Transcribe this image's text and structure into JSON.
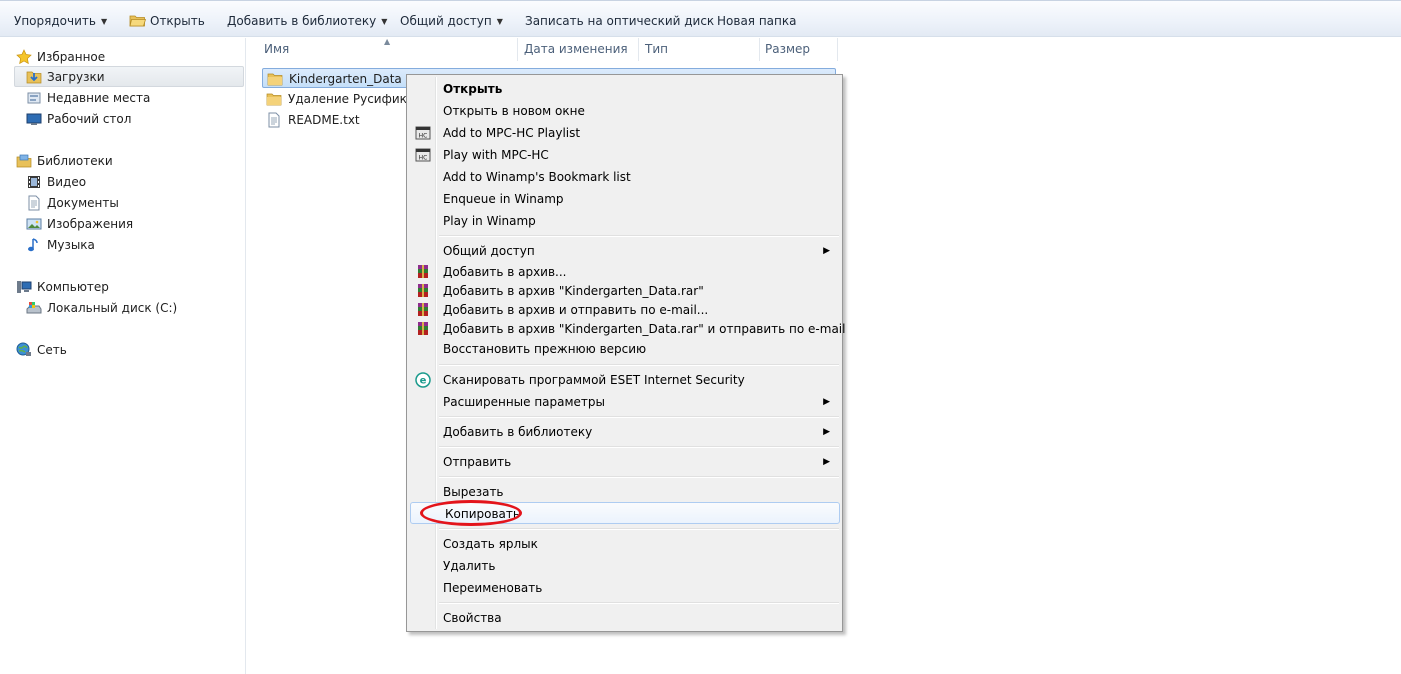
{
  "toolbar": {
    "organize": "Упорядочить",
    "open": "Открыть",
    "add_to_library": "Добавить в библиотеку",
    "share": "Общий доступ",
    "burn": "Записать на оптический диск",
    "new_folder": "Новая папка"
  },
  "nav": {
    "favorites": "Избранное",
    "downloads": "Загрузки",
    "recent": "Недавние места",
    "desktop": "Рабочий стол",
    "libraries": "Библиотеки",
    "video": "Видео",
    "documents": "Документы",
    "pictures": "Изображения",
    "music": "Музыка",
    "computer": "Компьютер",
    "local_disk": "Локальный диск (C:)",
    "network": "Сеть"
  },
  "columns": {
    "name": "Имя",
    "date": "Дата изменения",
    "type": "Тип",
    "size": "Размер"
  },
  "files": [
    {
      "name": "Kindergarten_Data",
      "icon": "folder-icon"
    },
    {
      "name": "Удаление Русификато",
      "icon": "folder-icon"
    },
    {
      "name": "README.txt",
      "icon": "text-file-icon"
    }
  ],
  "menu": {
    "open": "Открыть",
    "open_new_window": "Открыть в новом окне",
    "add_mpc_playlist": "Add to MPC-HC Playlist",
    "play_mpc": "Play with MPC-HC",
    "winamp_bookmark": "Add to Winamp's Bookmark list",
    "enqueue_winamp": "Enqueue in Winamp",
    "play_winamp": "Play in Winamp",
    "share": "Общий доступ",
    "add_archive": "Добавить в архив...",
    "add_archive_named": "Добавить в архив \"Kindergarten_Data.rar\"",
    "add_archive_email": "Добавить в архив и отправить по e-mail...",
    "add_archive_named_email": "Добавить в архив \"Kindergarten_Data.rar\" и отправить по e-mail",
    "restore_version": "Восстановить прежнюю версию",
    "eset_scan": "Сканировать программой ESET Internet Security",
    "advanced": "Расширенные параметры",
    "add_library": "Добавить в библиотеку",
    "send_to": "Отправить",
    "cut": "Вырезать",
    "copy": "Копировать",
    "create_shortcut": "Создать ярлык",
    "delete": "Удалить",
    "rename": "Переименовать",
    "properties": "Свойства"
  },
  "colors": {
    "highlight": "#e3141b",
    "selection": "#c5dff8",
    "menu_bg": "#f0f0f0"
  }
}
